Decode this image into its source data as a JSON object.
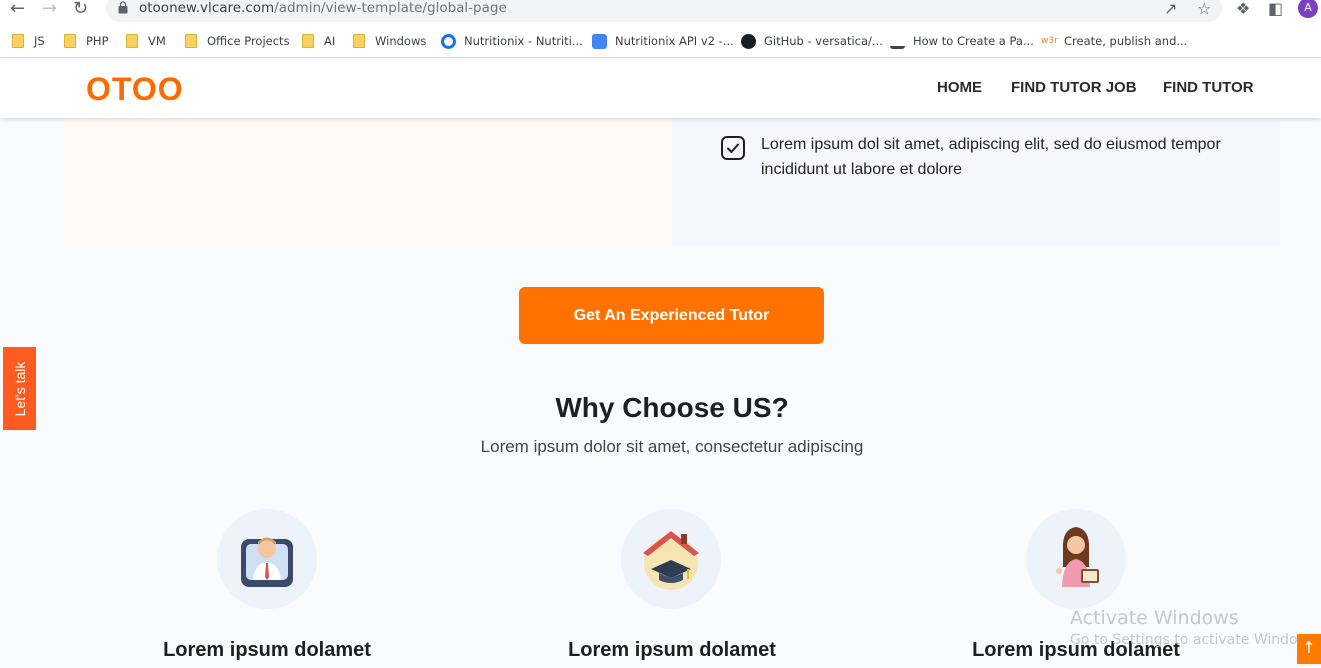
{
  "browser": {
    "url_host": "otoonew.vlcare.com",
    "url_path": "/admin/view-template/global-page",
    "avatar_letter": "A",
    "bookmarks": [
      {
        "label": "JS",
        "icon": "folder-icon"
      },
      {
        "label": "PHP",
        "icon": "folder-icon"
      },
      {
        "label": "VM",
        "icon": "folder-icon"
      },
      {
        "label": "Office Projects",
        "icon": "folder-icon"
      },
      {
        "label": "AI",
        "icon": "folder-icon"
      },
      {
        "label": "Windows",
        "icon": "folder-icon"
      },
      {
        "label": "Nutritionix - Nutriti...",
        "icon": "nutritionix-icon"
      },
      {
        "label": "Nutritionix API v2 -...",
        "icon": "docs-icon"
      },
      {
        "label": "GitHub - versatica/...",
        "icon": "github-icon"
      },
      {
        "label": "How to Create a Pa...",
        "icon": "bookmark-site-icon"
      },
      {
        "label": "Create, publish and...",
        "icon": "w3r-icon"
      }
    ]
  },
  "header": {
    "logo": "OTOO",
    "nav": [
      "HOME",
      "FIND TUTOR JOB",
      "FIND TUTOR"
    ]
  },
  "content": {
    "check_item": "Lorem ipsum dol sit amet, adipiscing elit, sed do eiusmod tempor incididunt ut labore et dolore",
    "cta_label": "Get An Experienced Tutor",
    "why_title": "Why Choose US?",
    "why_subtitle": "Lorem ipsum dolor sit amet, consectetur adipiscing",
    "features": [
      {
        "title": "Lorem ipsum dolamet",
        "icon": "online-tutor-icon"
      },
      {
        "title": "Lorem ipsum dolamet",
        "icon": "home-tuition-icon"
      },
      {
        "title": "Lorem ipsum dolamet",
        "icon": "female-tutor-icon"
      }
    ]
  },
  "side_tab": "Let's talk",
  "watermark": {
    "line1": "Activate Windows",
    "line2": "Go to Settings to activate Windows."
  },
  "colors": {
    "brand": "#ff6a00",
    "cta": "#ff7200"
  }
}
